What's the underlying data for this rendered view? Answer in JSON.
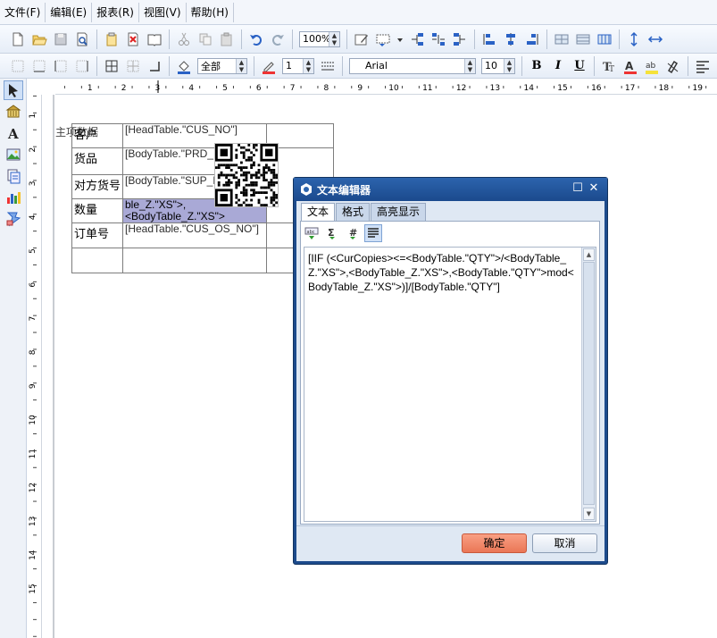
{
  "menu": [
    "文件(F)",
    "编辑(E)",
    "报表(R)",
    "视图(V)",
    "帮助(H)"
  ],
  "toolbar1": {
    "icons": [
      "new-icon",
      "open-icon",
      "save-icon",
      "print-preview-icon",
      "paste-special-icon",
      "delete-icon",
      "book-icon",
      "cut-icon",
      "copy-icon",
      "paste-icon",
      "undo-icon",
      "redo-icon"
    ],
    "zoom": "100%",
    "icons_right": [
      "edit-icon",
      "field-icon",
      "dropdown-icon",
      "align-left-tree-icon",
      "align-center-tree-icon",
      "align-right-tree-icon",
      "distribute-left-icon",
      "distribute-center-icon",
      "distribute-right-icon",
      "grid-icon",
      "grid2-icon",
      "grid3-icon",
      "vspace-icon",
      "hspace-icon"
    ]
  },
  "toolbar2": {
    "border_scope": "全部",
    "line_width": "1",
    "font_name": "Arial",
    "font_size": "10",
    "bold": "B",
    "italic": "I",
    "underline": "U"
  },
  "left_tools": [
    "pointer-icon",
    "database-icon",
    "text-icon",
    "image-icon",
    "subreport-icon",
    "chart-icon",
    "barcode-icon"
  ],
  "hruler_labels": [
    "1",
    "2",
    "3",
    "4",
    "5",
    "6",
    "7",
    "8",
    "9",
    "10",
    "11",
    "12",
    "13",
    "14",
    "15",
    "16",
    "17",
    "18",
    "19"
  ],
  "vruler_labels": [
    "1",
    "2",
    "3",
    "4",
    "5",
    "6",
    "7",
    "8",
    "9",
    "10",
    "11",
    "12",
    "13",
    "14",
    "15"
  ],
  "report": {
    "section_label": "主项数据",
    "rows": [
      {
        "label": "客户",
        "value": "[HeadTable.\"CUS_NO\"]"
      },
      {
        "label": "货品",
        "value": "[BodyTable.\"PRD_NO\"]"
      },
      {
        "label": "对方货号",
        "value": "[BodyTable.\"SUP_PRD_NO\"]"
      },
      {
        "label": "数量",
        "value": "ble_Z.\"XS\">,<BodyTable_Z.\"XS\">"
      },
      {
        "label": "订单号",
        "value": "[HeadTable.\"CUS_OS_NO\"]"
      },
      {
        "label": "",
        "value": ""
      }
    ]
  },
  "dialog": {
    "title": "文本编辑器",
    "tabs": [
      "文本",
      "格式",
      "高亮显示"
    ],
    "content": "[IIF (<CurCopies><=<BodyTable.\"QTY\">/<BodyTable_Z.\"XS\">,<BodyTable_Z.\"XS\">,<BodyTable.\"QTY\">mod<BodyTable_Z.\"XS\">)]/[BodyTable.\"QTY\"]",
    "ok_label": "确定",
    "cancel_label": "取消"
  },
  "colors": {
    "dialog_title": "#2c64ad",
    "ok_button": "#f48e6e",
    "selected_cell": "#a9a9d6"
  }
}
